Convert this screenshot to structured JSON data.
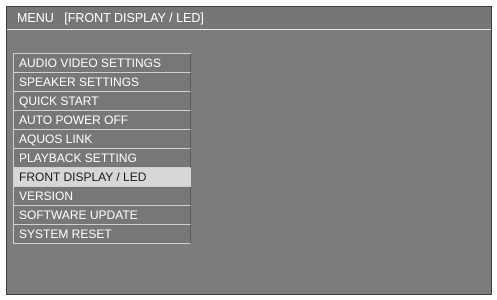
{
  "title_bar": {
    "menu_label": "MENU",
    "section_label": "[FRONT DISPLAY / LED]"
  },
  "menu": {
    "selected_index": 6,
    "items": [
      {
        "label": "AUDIO VIDEO SETTINGS"
      },
      {
        "label": "SPEAKER SETTINGS"
      },
      {
        "label": "QUICK START"
      },
      {
        "label": "AUTO POWER OFF"
      },
      {
        "label": "AQUOS LINK"
      },
      {
        "label": "PLAYBACK SETTING"
      },
      {
        "label": "FRONT DISPLAY / LED"
      },
      {
        "label": "VERSION"
      },
      {
        "label": "SOFTWARE UPDATE"
      },
      {
        "label": "SYSTEM RESET"
      }
    ]
  },
  "colors": {
    "screen_background": "#7c7c7c",
    "item_background": "#777777",
    "selected_background": "#d7d7d7",
    "text": "#ffffff",
    "selected_text": "#1a1a1a"
  }
}
